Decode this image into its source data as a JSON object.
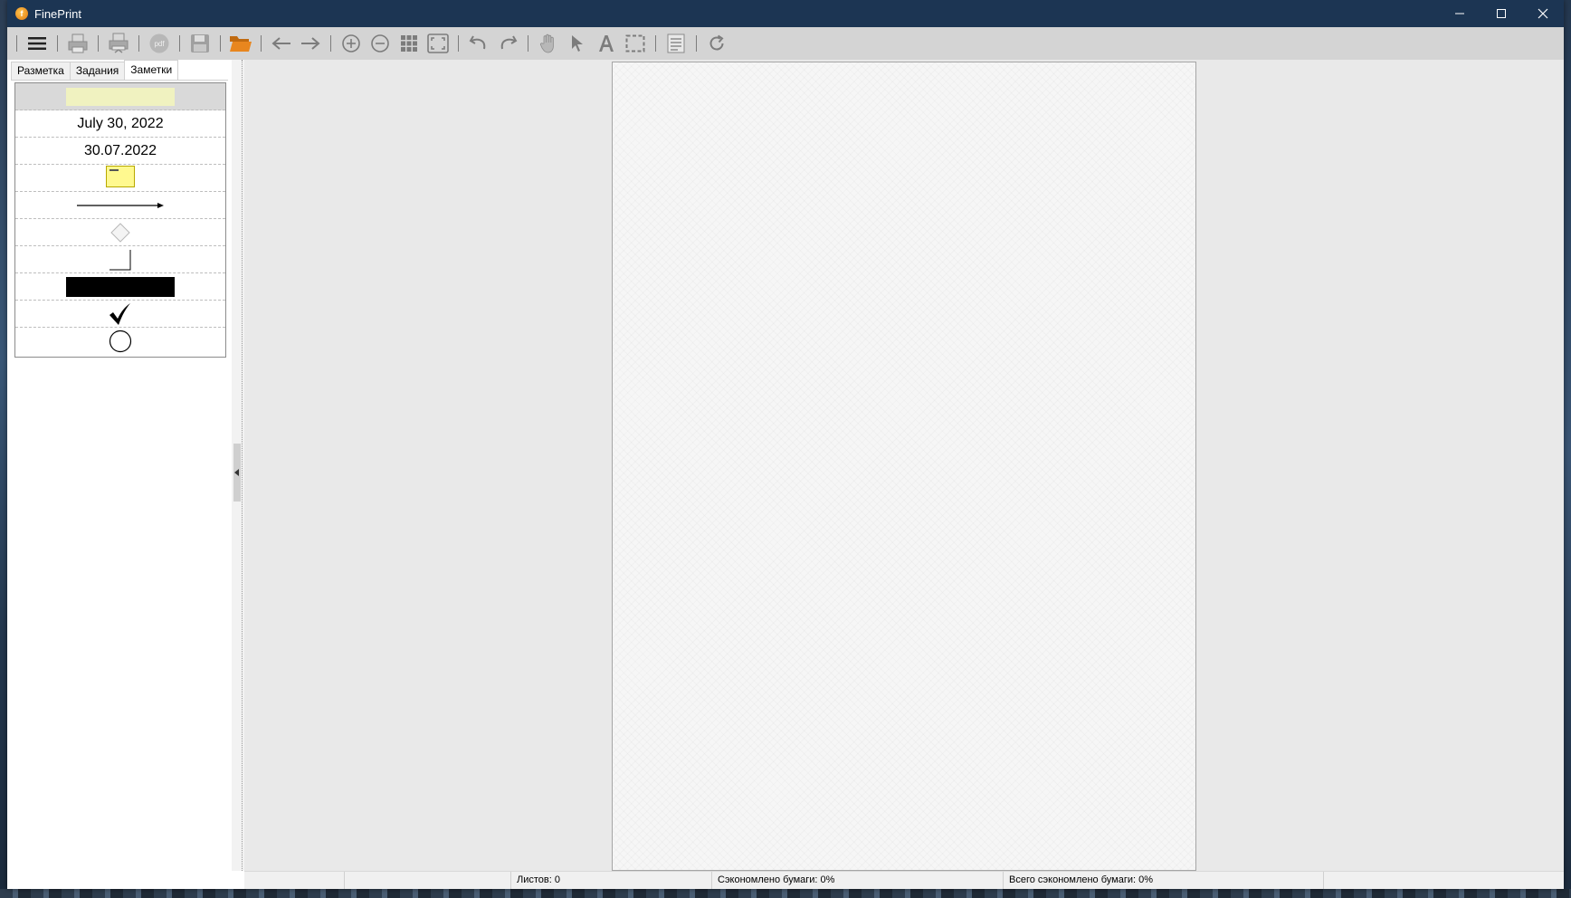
{
  "window": {
    "title": "FinePrint",
    "controls": {
      "minimize": "—",
      "maximize": "☐",
      "close": "✕"
    }
  },
  "toolbar": {
    "buttons": [
      {
        "name": "menu-icon"
      },
      {
        "name": "print-icon"
      },
      {
        "name": "print-settings-icon"
      },
      {
        "name": "pdf-icon"
      },
      {
        "name": "save-icon"
      },
      {
        "name": "open-folder-icon"
      },
      {
        "name": "arrow-left-icon"
      },
      {
        "name": "arrow-right-icon"
      },
      {
        "name": "zoom-in-icon"
      },
      {
        "name": "zoom-out-icon"
      },
      {
        "name": "grid-view-icon"
      },
      {
        "name": "fit-page-icon"
      },
      {
        "name": "undo-icon"
      },
      {
        "name": "redo-icon"
      },
      {
        "name": "hand-icon"
      },
      {
        "name": "pointer-icon"
      },
      {
        "name": "text-icon"
      },
      {
        "name": "select-area-icon"
      },
      {
        "name": "page-info-icon"
      },
      {
        "name": "refresh-icon"
      }
    ],
    "pdf_label": "pdf"
  },
  "tabs": [
    {
      "label": "Разметка",
      "active": false
    },
    {
      "label": "Задания",
      "active": false
    },
    {
      "label": "Заметки",
      "active": true
    }
  ],
  "notes": {
    "date_long": "July 30, 2022",
    "date_short": "30.07.2022"
  },
  "status": {
    "sheets": "Листов: 0",
    "saved": "Сэкономлено бумаги: 0%",
    "total_saved": "Всего сэкономлено бумаги: 0%"
  },
  "colors": {
    "titlebar": "#1c3553",
    "toolbar": "#d4d4d4",
    "highlight_swatch": "#f0f2c0",
    "sticky_note": "#fff98f",
    "folder_orange": "#e8861e"
  }
}
